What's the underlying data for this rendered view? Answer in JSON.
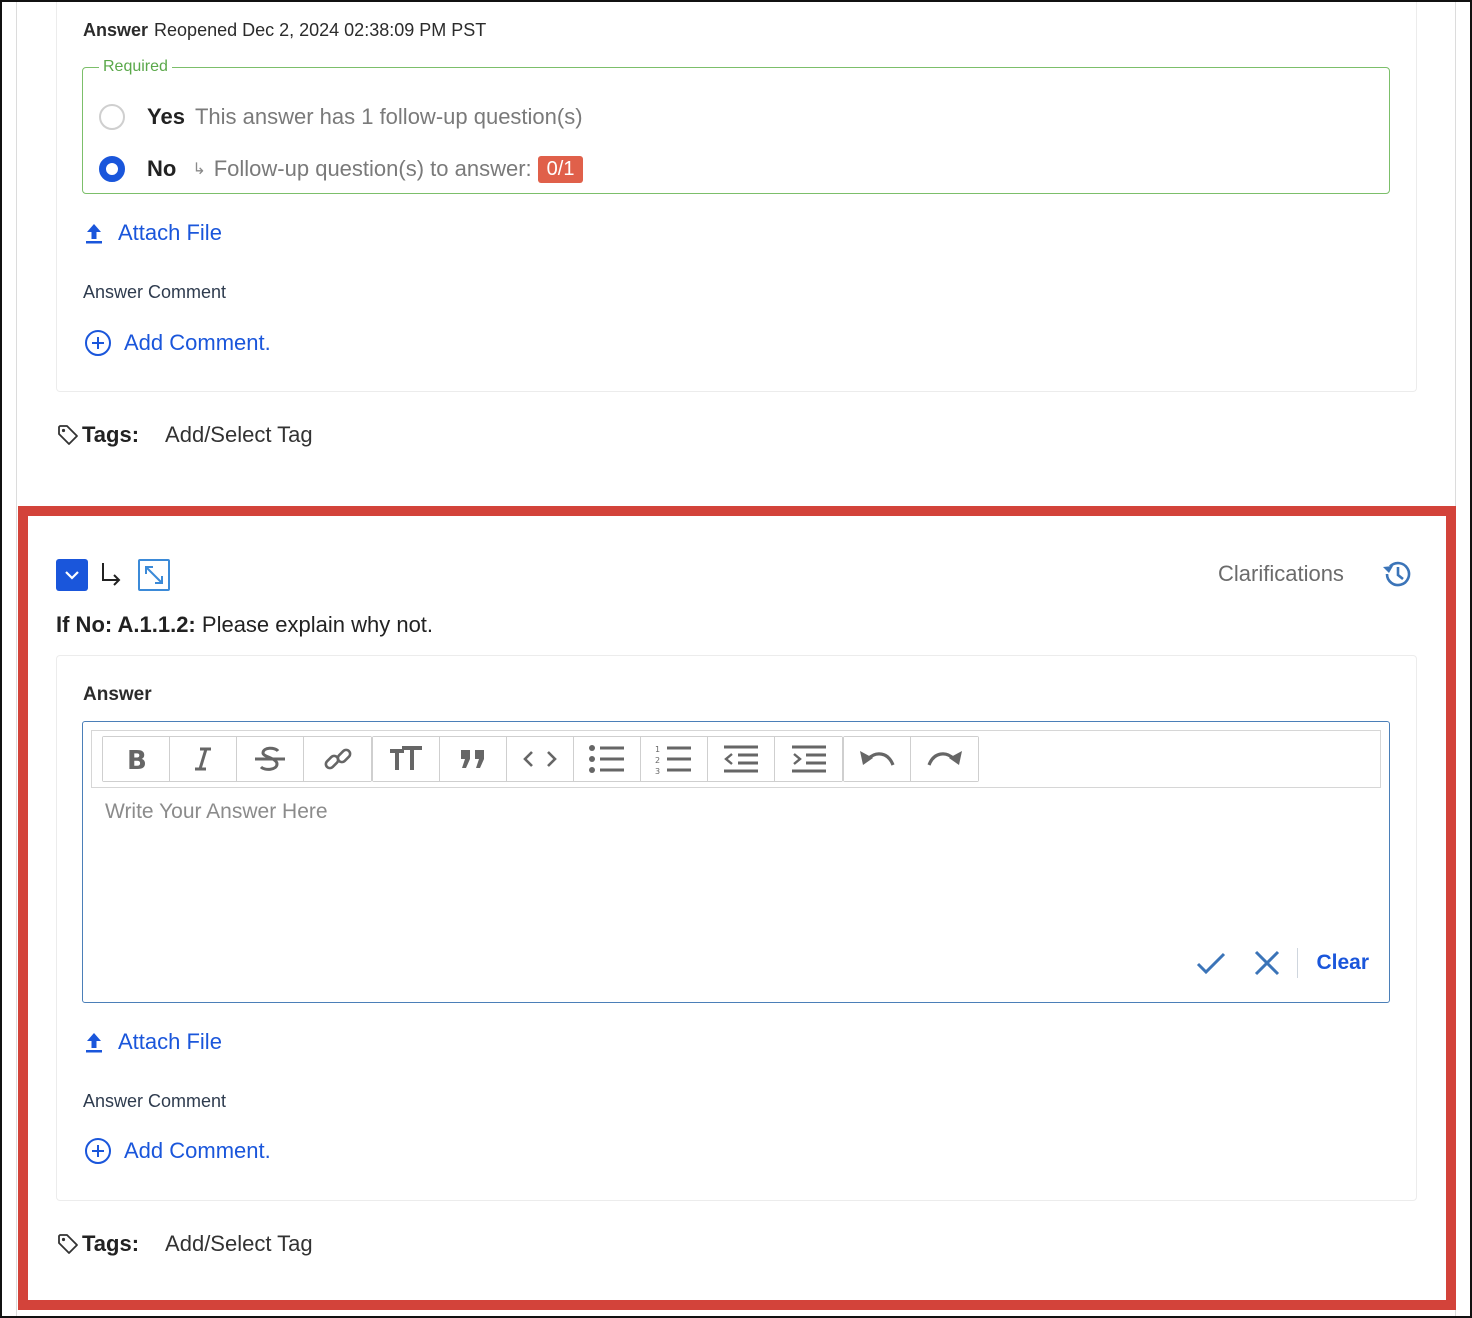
{
  "top_section": {
    "answer_label": "Answer",
    "answer_status": "Reopened Dec 2, 2024 02:38:09 PM PST",
    "required_legend": "Required",
    "options": [
      {
        "label": "Yes",
        "note": "This answer has 1 follow-up question(s)",
        "checked": false
      },
      {
        "label": "No",
        "note": "Follow-up question(s) to answer:",
        "badge": "0/1",
        "checked": true
      }
    ],
    "attach_file": "Attach File",
    "answer_comment_label": "Answer Comment",
    "add_comment": "Add Comment.",
    "tags_label": "Tags:",
    "tags_value": "Add/Select Tag"
  },
  "followup": {
    "clarifications": "Clarifications",
    "question_prefix": "If No: A.1.1.2:",
    "question_text": "Please explain why not.",
    "answer_label": "Answer",
    "editor_placeholder": "Write Your Answer Here",
    "toolbar": [
      "bold-icon",
      "italic-icon",
      "strikethrough-icon",
      "link-icon",
      "text-size-icon",
      "quote-icon",
      "code-icon",
      "bullet-list-icon",
      "numbered-list-icon",
      "outdent-icon",
      "indent-icon",
      "undo-icon",
      "redo-icon"
    ],
    "clear": "Clear",
    "attach_file": "Attach File",
    "answer_comment_label": "Answer Comment",
    "add_comment": "Add Comment.",
    "tags_label": "Tags:",
    "tags_value": "Add/Select Tag"
  },
  "colors": {
    "accent": "#1a56db",
    "required_green": "#5aa84a",
    "badge_red": "#e0604a",
    "highlight_red": "#d3433a"
  }
}
